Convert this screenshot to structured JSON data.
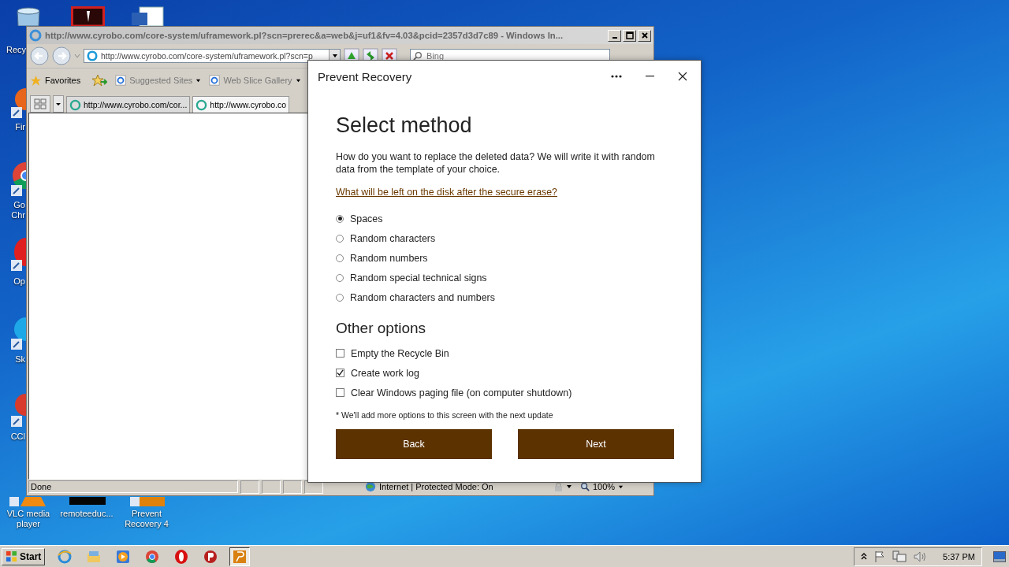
{
  "desktop": {
    "icons": [
      {
        "kind": "recycle-bin",
        "lines": [
          "Recy"
        ]
      },
      {
        "kind": "pdf"
      },
      {
        "kind": "word"
      },
      {
        "kind": "firefox",
        "lines": [
          "Fir"
        ]
      },
      {
        "kind": "chrome",
        "lines": [
          "Go",
          "Chr"
        ]
      },
      {
        "kind": "opera",
        "lines": [
          "Op"
        ]
      },
      {
        "kind": "skype",
        "lines": [
          "Sk"
        ]
      },
      {
        "kind": "ccleaner",
        "lines": [
          "CCl"
        ]
      },
      {
        "kind": "vlc",
        "lines": [
          "VLC media",
          "player"
        ]
      },
      {
        "kind": "black-file",
        "lines": [
          "remoteeduc..."
        ]
      },
      {
        "kind": "prevent-recovery",
        "lines": [
          "Prevent",
          "Recovery 4"
        ]
      }
    ]
  },
  "browser": {
    "title": "http://www.cyrobo.com/core-system/uframework.pl?scn=prerec&a=web&j=uf1&fv=4.03&pcid=2357d3d7c89 - Windows In...",
    "address": "http://www.cyrobo.com/core-system/uframework.pl?scn=p",
    "search": {
      "placeholder": "Bing"
    },
    "favorites": [
      {
        "kind": "favorites",
        "label": "Favorites"
      },
      {
        "kind": "page",
        "label": "Suggested Sites"
      },
      {
        "kind": "page",
        "label": "Web Slice Gallery"
      }
    ],
    "tabs": [
      {
        "label": "http://www.cyrobo.com/cor...",
        "selected": false
      },
      {
        "label": "http://www.cyrobo.co",
        "selected": true
      }
    ],
    "status": {
      "text": "Done",
      "zone": "Internet | Protected Mode: On",
      "zoom": "100%"
    }
  },
  "dialog": {
    "title": "Prevent Recovery",
    "heading": "Select method",
    "description": "How do you want to replace the deleted data? We will write it with random data from the template of your choice.",
    "link": "What will be left on the disk after the secure erase?",
    "methods": [
      {
        "label": "Spaces",
        "selected": true
      },
      {
        "label": "Random characters",
        "selected": false
      },
      {
        "label": "Random numbers",
        "selected": false
      },
      {
        "label": "Random special technical signs",
        "selected": false
      },
      {
        "label": "Random characters and numbers",
        "selected": false
      }
    ],
    "options_heading": "Other options",
    "options": [
      {
        "label": "Empty the Recycle Bin",
        "checked": false
      },
      {
        "label": "Create work log",
        "checked": true
      },
      {
        "label": "Clear Windows paging file (on computer shutdown)",
        "checked": false
      }
    ],
    "note": "* We'll add more options to this screen with the next update",
    "buttons": [
      {
        "label": "Back"
      },
      {
        "label": "Next"
      }
    ]
  },
  "taskbar": {
    "start": "Start",
    "apps": [
      {
        "kind": "ie",
        "selected": false
      },
      {
        "kind": "folder",
        "selected": false
      },
      {
        "kind": "media",
        "selected": false
      },
      {
        "kind": "chrome",
        "selected": false
      },
      {
        "kind": "opera",
        "selected": false
      },
      {
        "kind": "p-red",
        "selected": false
      },
      {
        "kind": "prevent-recovery",
        "selected": true
      }
    ],
    "time": "5:37 PM"
  }
}
